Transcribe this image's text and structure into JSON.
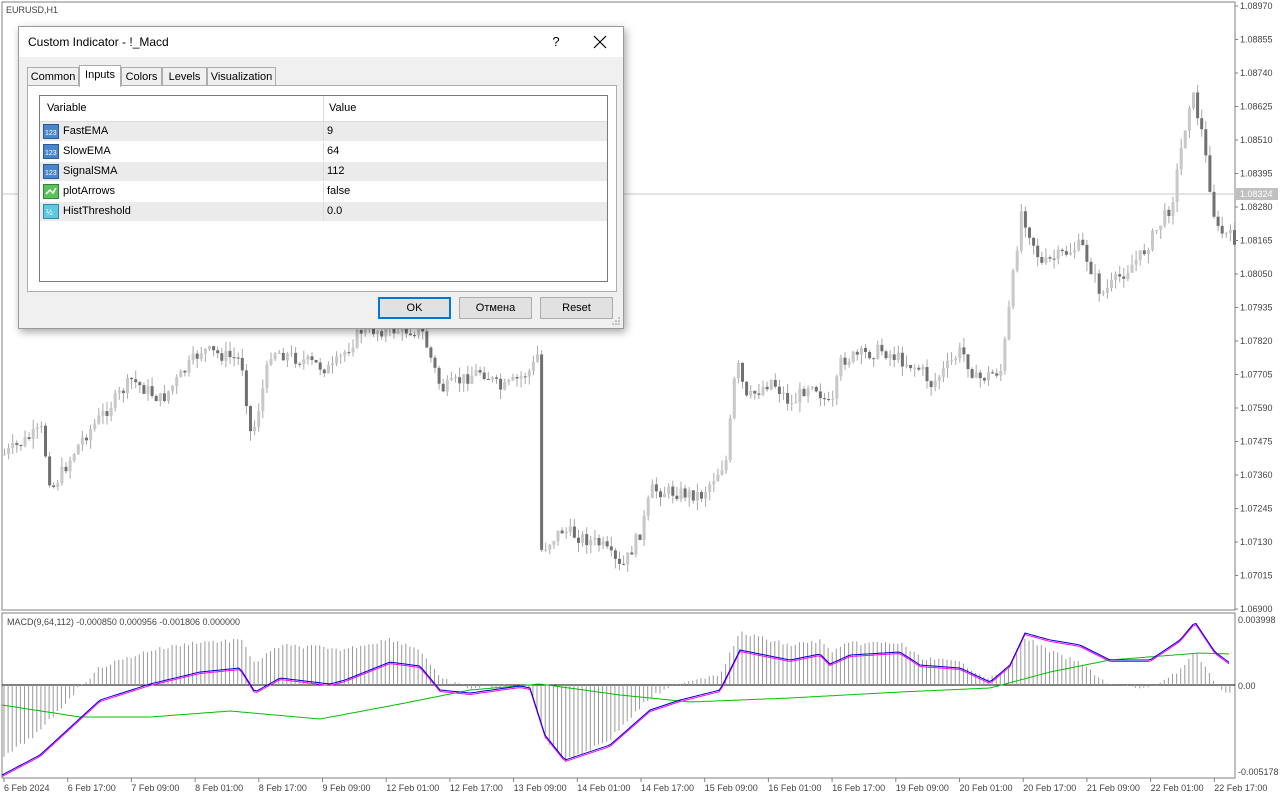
{
  "chart": {
    "symbol_label": "EURUSD,H1",
    "price_labels": [
      "1.08970",
      "1.08855",
      "1.08740",
      "1.08625",
      "1.08510",
      "1.08395",
      "1.08280",
      "1.08165",
      "1.08050",
      "1.07935",
      "1.07820",
      "1.07705",
      "1.07590",
      "1.07475",
      "1.07360",
      "1.07245",
      "1.07130",
      "1.07015",
      "1.06900"
    ],
    "current_price": "1.08324",
    "indicator_label": "MACD(9,64,112) -0.000850 0.000956 -0.001806 0.000000",
    "indicator_scale": [
      "0.003998",
      "0.00",
      "-0.005178"
    ],
    "time_labels": [
      "6 Feb 2024",
      "6 Feb 17:00",
      "7 Feb 09:00",
      "8 Feb 01:00",
      "8 Feb 17:00",
      "9 Feb 09:00",
      "12 Feb 01:00",
      "12 Feb 17:00",
      "13 Feb 09:00",
      "14 Feb 01:00",
      "14 Feb 17:00",
      "15 Feb 09:00",
      "16 Feb 01:00",
      "16 Feb 17:00",
      "19 Feb 09:00",
      "20 Feb 01:00",
      "20 Feb 17:00",
      "21 Feb 09:00",
      "22 Feb 01:00",
      "22 Feb 17:00"
    ],
    "colors": {
      "candle": "#808080",
      "macd_line": "#0000cc",
      "signal_line": "#00c000",
      "histogram": "#a0a0a0",
      "accent": "#ff00ff"
    }
  },
  "dialog": {
    "title": "Custom Indicator - !_Macd",
    "help_label": "?",
    "tabs": [
      {
        "label": "Common"
      },
      {
        "label": "Inputs"
      },
      {
        "label": "Colors"
      },
      {
        "label": "Levels"
      },
      {
        "label": "Visualization"
      }
    ],
    "active_tab": "Inputs",
    "columns": {
      "variable": "Variable",
      "value": "Value"
    },
    "params": [
      {
        "name": "FastEMA",
        "value": "9",
        "icon": "int-icon"
      },
      {
        "name": "SlowEMA",
        "value": "64",
        "icon": "int-icon"
      },
      {
        "name": "SignalSMA",
        "value": "112",
        "icon": "int-icon"
      },
      {
        "name": "plotArrows",
        "value": "false",
        "icon": "bool-icon"
      },
      {
        "name": "HistThreshold",
        "value": "0.0",
        "icon": "double-icon"
      }
    ],
    "buttons": {
      "ok": "OK",
      "cancel": "Отмена",
      "reset": "Reset"
    }
  }
}
